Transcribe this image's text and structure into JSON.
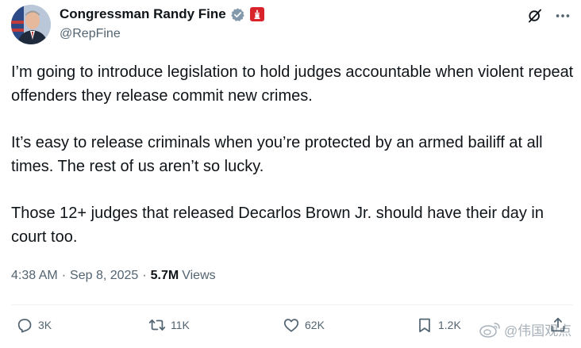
{
  "author": {
    "display_name": "Congressman Randy Fine",
    "handle": "@RepFine"
  },
  "tweet": {
    "paragraphs": [
      "I’m going to introduce legislation to hold judges accountable when violent repeat offenders they release commit new crimes.",
      "It’s easy to release criminals when you’re protected by an armed bailiff at all times. The rest of us aren’t so lucky.",
      "Those 12+ judges that released Decarlos Brown Jr. should have their day in court too."
    ],
    "time": "4:38 AM",
    "separator": "·",
    "date": "Sep 8, 2025",
    "views_count": "5.7M",
    "views_label": "Views"
  },
  "actions": {
    "replies": "3K",
    "reposts": "11K",
    "likes": "62K",
    "bookmarks": "1.2K"
  },
  "watermark": {
    "text": "@伟国观点"
  },
  "icons": {
    "verified": "verified-badge-icon",
    "affiliation": "government-affiliation-icon",
    "grok": "grok-icon",
    "more": "more-icon",
    "reply": "reply-icon",
    "repost": "repost-icon",
    "like": "like-icon",
    "bookmark": "bookmark-icon",
    "share": "share-icon"
  },
  "colors": {
    "text": "#0f1419",
    "secondary": "#536471",
    "verified": "#829aab",
    "affiliation": "#d8232a",
    "divider": "#eff3f4"
  }
}
